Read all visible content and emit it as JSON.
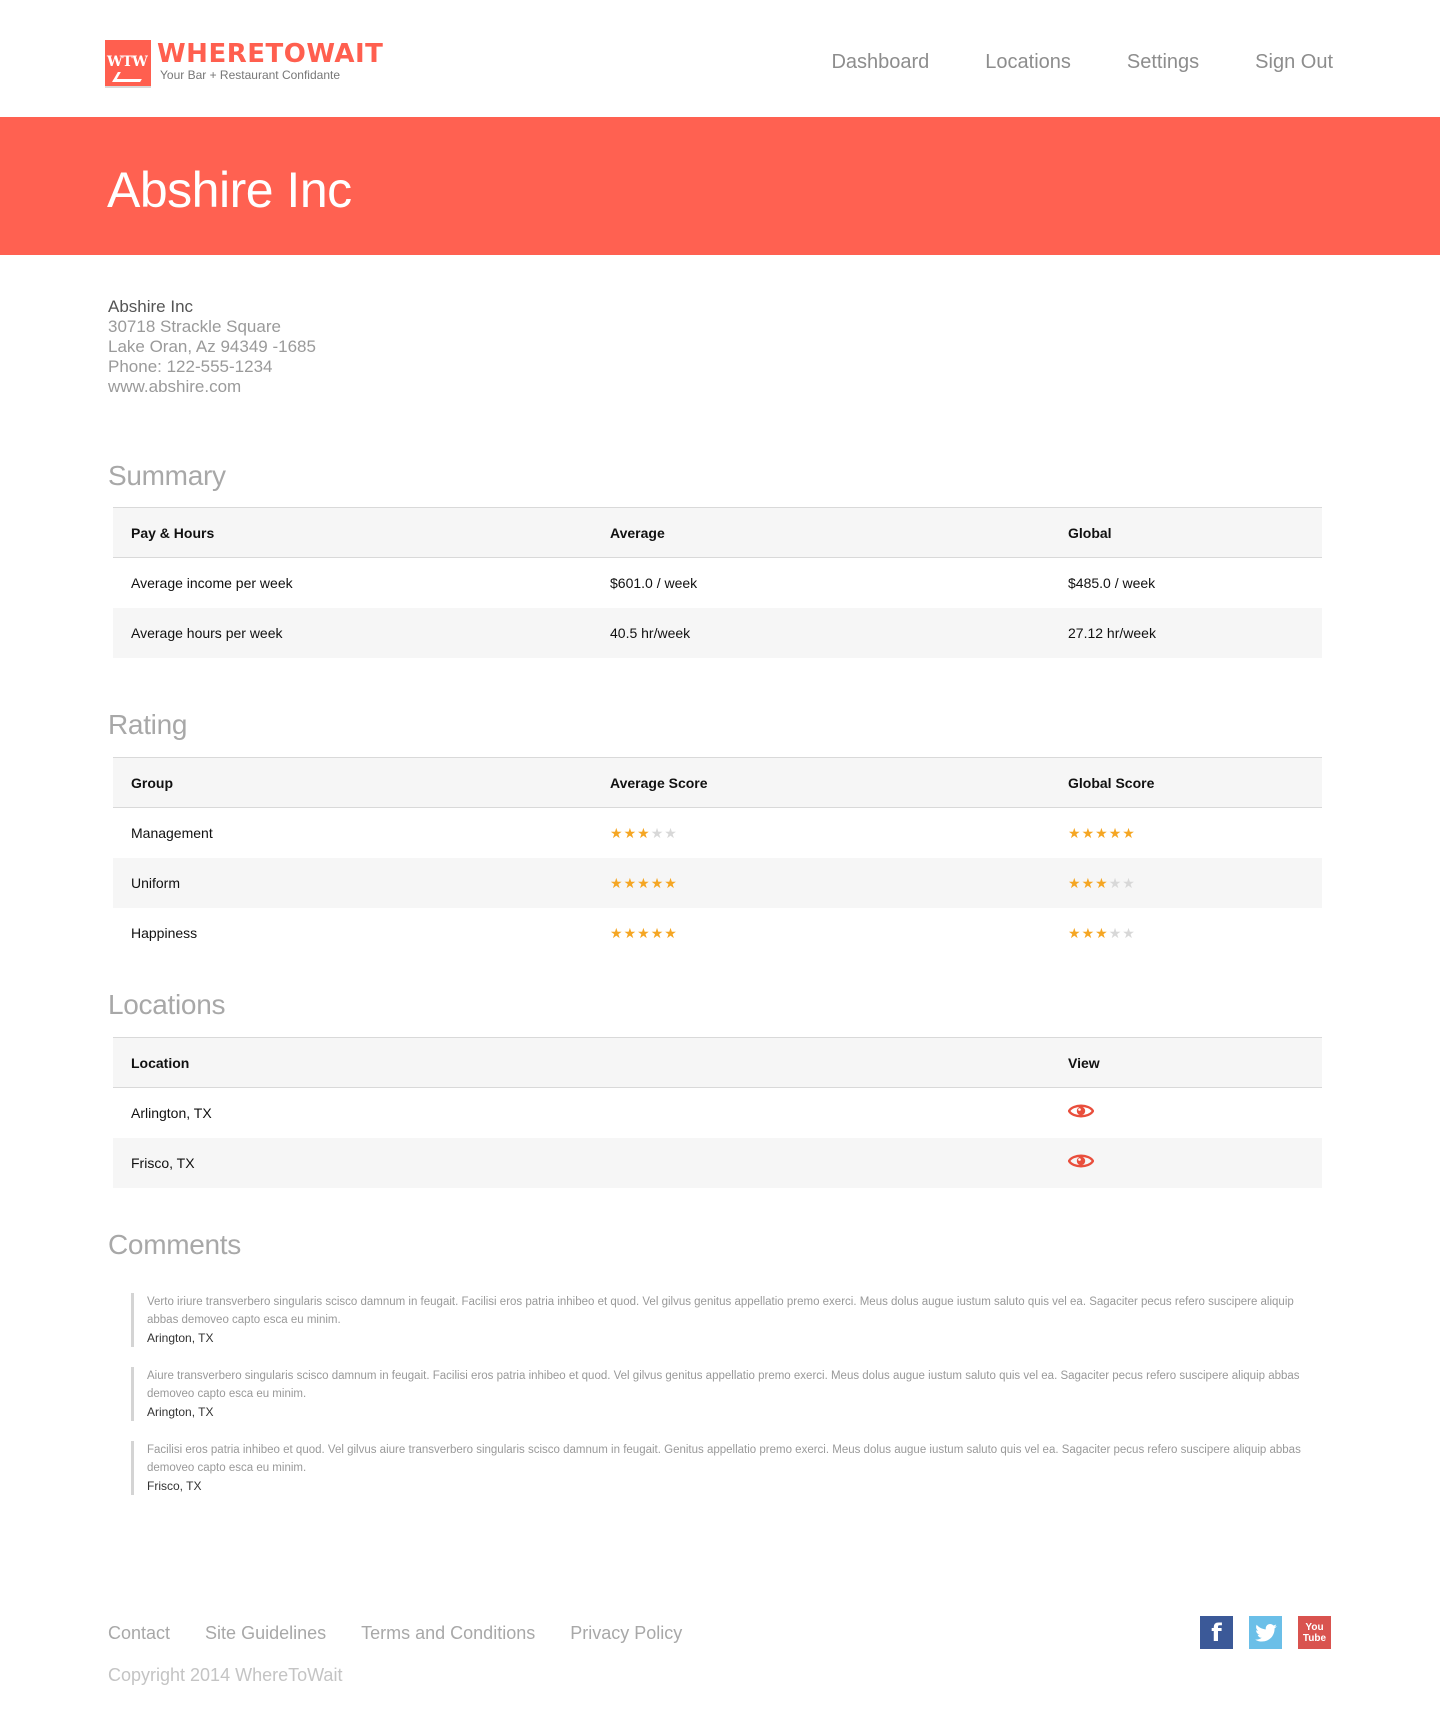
{
  "brand": {
    "mark": "WTW",
    "title": "WHERETOWAIT",
    "tagline": "Your Bar + Restaurant Confidante",
    "accent": "#ff6151"
  },
  "nav": [
    "Dashboard",
    "Locations",
    "Settings",
    "Sign Out"
  ],
  "banner": {
    "title": "Abshire Inc"
  },
  "address": {
    "name": "Abshire Inc",
    "street": "30718 Strackle Square",
    "city": "Lake Oran, Az 94349 -1685",
    "phone": "Phone: 122-555-1234",
    "website": "www.abshire.com"
  },
  "summary": {
    "title": "Summary",
    "headers": [
      "Pay & Hours",
      "Average",
      "Global"
    ],
    "rows": [
      [
        "Average income per week",
        "$601.0 / week",
        "$485.0 / week"
      ],
      [
        "Average hours per week",
        "40.5 hr/week",
        "27.12 hr/week"
      ]
    ]
  },
  "rating": {
    "title": "Rating",
    "headers": [
      "Group",
      "Average Score",
      "Global Score"
    ],
    "rows": [
      {
        "group": "Management",
        "average": 3,
        "global": 5
      },
      {
        "group": "Uniform",
        "average": 5,
        "global": 3
      },
      {
        "group": "Happiness",
        "average": 5,
        "global": 3
      }
    ],
    "max_stars": 5,
    "star_on_color": "#f5a623",
    "star_off_color": "#d8d8d8"
  },
  "locations": {
    "title": "Locations",
    "headers": [
      "Location",
      "View"
    ],
    "rows": [
      {
        "name": "Arlington, TX",
        "icon": "eye-icon"
      },
      {
        "name": "Frisco, TX",
        "icon": "eye-icon"
      }
    ]
  },
  "comments": {
    "title": "Comments",
    "items": [
      {
        "text": "Verto iriure transverbero singularis scisco damnum in feugait. Facilisi eros patria inhibeo et quod. Vel gilvus genitus appellatio premo exerci. Meus dolus augue iustum saluto quis vel ea. Sagaciter pecus refero suscipere aliquip abbas demoveo capto esca eu minim.",
        "location": "Arington, TX"
      },
      {
        "text": "Aiure transverbero singularis scisco damnum in feugait. Facilisi eros patria inhibeo et quod. Vel gilvus genitus appellatio premo exerci. Meus dolus augue iustum saluto quis vel ea. Sagaciter pecus refero suscipere aliquip abbas demoveo capto esca eu minim.",
        "location": "Arington, TX"
      },
      {
        "text": "Facilisi eros patria inhibeo et quod. Vel gilvus aiure transverbero singularis scisco damnum in feugait. Genitus appellatio premo exerci. Meus dolus augue iustum saluto quis vel ea. Sagaciter pecus refero suscipere aliquip abbas demoveo capto esca eu minim.",
        "location": "Frisco, TX"
      }
    ]
  },
  "footer": {
    "links": [
      "Contact",
      "Site Guidelines",
      "Terms and Conditions",
      "Privacy Policy"
    ],
    "copyright": "Copyright 2014 WhereToWait",
    "social": [
      {
        "name": "facebook-icon",
        "glyph": "f"
      },
      {
        "name": "twitter-icon",
        "glyph": "🐦"
      },
      {
        "name": "youtube-icon",
        "glyph_top": "You",
        "glyph_bottom": "Tube"
      }
    ]
  }
}
